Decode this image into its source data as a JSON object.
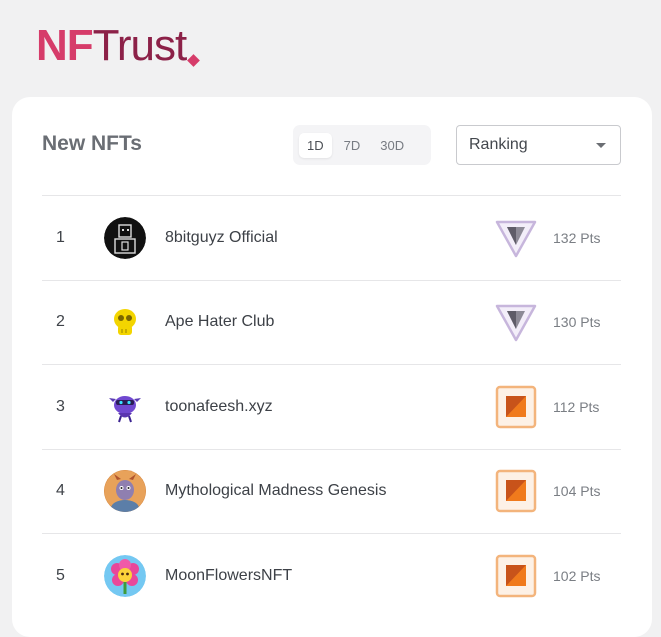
{
  "brand": {
    "nf": "NF",
    "trust": "Trust"
  },
  "card": {
    "title": "New NFTs",
    "periods": [
      "1D",
      "7D",
      "30D"
    ],
    "sort": {
      "value": "Ranking"
    }
  },
  "rows": [
    {
      "rank": "1",
      "name": "8bitguyz Official",
      "points": "132 Pts",
      "tier": "silver"
    },
    {
      "rank": "2",
      "name": "Ape Hater Club",
      "points": "130 Pts",
      "tier": "silver"
    },
    {
      "rank": "3",
      "name": "toonafeesh.xyz",
      "points": "112 Pts",
      "tier": "bronze"
    },
    {
      "rank": "4",
      "name": "Mythological Madness Genesis",
      "points": "104 Pts",
      "tier": "bronze"
    },
    {
      "rank": "5",
      "name": "MoonFlowersNFT",
      "points": "102 Pts",
      "tier": "bronze"
    }
  ],
  "colors": {
    "brand_primary": "#d63c6a",
    "brand_dark": "#8c2148",
    "silver_badge": "#c7b6dc",
    "bronze_badge": "#f0a05a"
  }
}
